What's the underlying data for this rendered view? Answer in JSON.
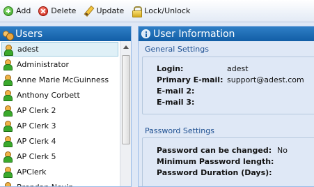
{
  "toolbar": {
    "add_label": "Add",
    "delete_label": "Delete",
    "update_label": "Update",
    "lock_label": "Lock/Unlock"
  },
  "users_panel": {
    "title": "Users",
    "items": [
      "adest",
      "Administrator",
      "Anne Marie McGuinness",
      "Anthony Corbett",
      "AP Clerk 2",
      "AP Clerk 3",
      "AP Clerk 4",
      "AP Clerk 5",
      "APClerk",
      "Brendan Nevin"
    ],
    "selected_index": 0
  },
  "info_panel": {
    "title": "User Information",
    "general": {
      "title": "General Settings",
      "login_label": "Login:",
      "login_value": "adest",
      "primary_email_label": "Primary E-mail:",
      "primary_email_value": "support@adest.com",
      "email2_label": "E-mail 2:",
      "email3_label": "E-mail 3:"
    },
    "password": {
      "title": "Password Settings",
      "can_change_label": "Password can be changed:",
      "can_change_value": "No",
      "min_length_label": "Minimum Password length:",
      "duration_label": "Password Duration (Days):"
    }
  }
}
